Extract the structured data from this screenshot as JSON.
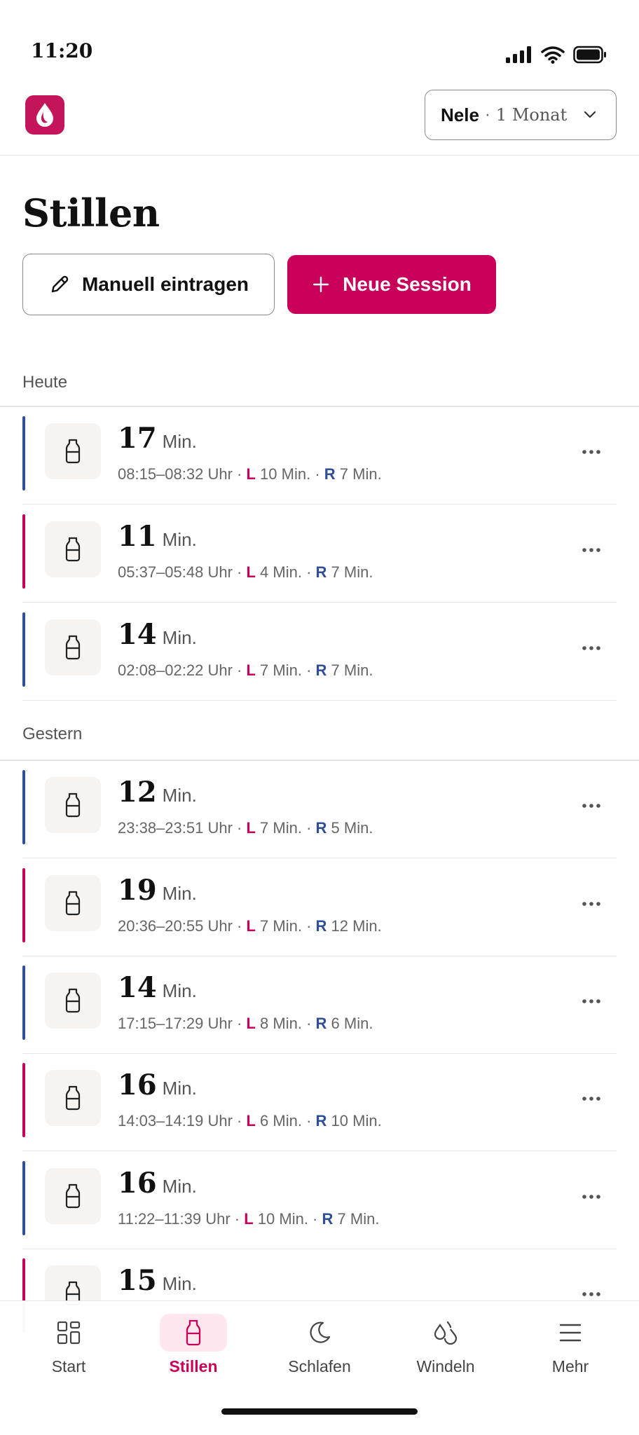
{
  "status_bar": {
    "time": "11:20"
  },
  "header": {
    "child_name": "Nele",
    "child_age": "1 Monat"
  },
  "page": {
    "title": "Stillen"
  },
  "actions": {
    "manual_label": "Manuell eintragen",
    "new_session_label": "Neue Session"
  },
  "sections": [
    {
      "label": "Heute",
      "sessions": [
        {
          "duration": "17",
          "unit": "Min.",
          "time_range": "08:15–08:32 Uhr",
          "left": "10 Min.",
          "right": "7 Min.",
          "side": "R"
        },
        {
          "duration": "11",
          "unit": "Min.",
          "time_range": "05:37–05:48 Uhr",
          "left": "4 Min.",
          "right": "7 Min.",
          "side": "L"
        },
        {
          "duration": "14",
          "unit": "Min.",
          "time_range": "02:08–02:22 Uhr",
          "left": "7 Min.",
          "right": "7 Min.",
          "side": "R"
        }
      ]
    },
    {
      "label": "Gestern",
      "sessions": [
        {
          "duration": "12",
          "unit": "Min.",
          "time_range": "23:38–23:51 Uhr",
          "left": "7 Min.",
          "right": "5 Min.",
          "side": "R"
        },
        {
          "duration": "19",
          "unit": "Min.",
          "time_range": "20:36–20:55 Uhr",
          "left": "7 Min.",
          "right": "12 Min.",
          "side": "L"
        },
        {
          "duration": "14",
          "unit": "Min.",
          "time_range": "17:15–17:29 Uhr",
          "left": "8 Min.",
          "right": "6 Min.",
          "side": "R"
        },
        {
          "duration": "16",
          "unit": "Min.",
          "time_range": "14:03–14:19 Uhr",
          "left": "6 Min.",
          "right": "10 Min.",
          "side": "L"
        },
        {
          "duration": "16",
          "unit": "Min.",
          "time_range": "11:22–11:39 Uhr",
          "left": "10 Min.",
          "right": "7 Min.",
          "side": "R"
        },
        {
          "duration": "15",
          "unit": "Min.",
          "time_range": "",
          "left": "",
          "right": "",
          "side": "L"
        }
      ]
    }
  ],
  "side_labels": {
    "left": "L",
    "right": "R"
  },
  "colors": {
    "accent": "#c8005a",
    "left_side": "#c8005a",
    "right_side": "#2f4f9a",
    "logo_bg": "#c4155a"
  },
  "nav": [
    {
      "label": "Start",
      "icon": "grid-icon",
      "active": false
    },
    {
      "label": "Stillen",
      "icon": "bottle-icon",
      "active": true
    },
    {
      "label": "Schlafen",
      "icon": "moon-icon",
      "active": false
    },
    {
      "label": "Windeln",
      "icon": "drops-icon",
      "active": false
    },
    {
      "label": "Mehr",
      "icon": "menu-icon",
      "active": false
    }
  ]
}
